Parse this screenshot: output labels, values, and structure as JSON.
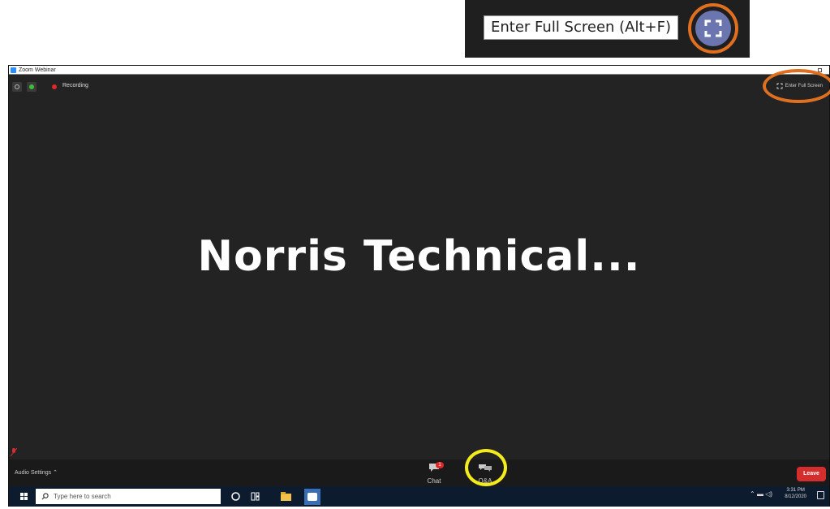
{
  "callout": {
    "tooltip": "Enter Full Screen (Alt+F)",
    "button_icon": "fullscreen-icon",
    "highlight_color": "#e07020"
  },
  "window": {
    "title": "Zoom Webinar",
    "recording_label": "Recording",
    "fullscreen_label": "Enter Full Screen",
    "shared_content_text": "Norris  Technical..."
  },
  "controls": {
    "audio_settings": "Audio Settings",
    "chat_label": "Chat",
    "chat_badge": "1",
    "qa_label": "Q&A",
    "leave_label": "Leave",
    "qa_highlight_color": "#f4ec1a"
  },
  "taskbar": {
    "search_placeholder": "Type here to search",
    "time": "3:31 PM",
    "date": "8/12/2020"
  }
}
